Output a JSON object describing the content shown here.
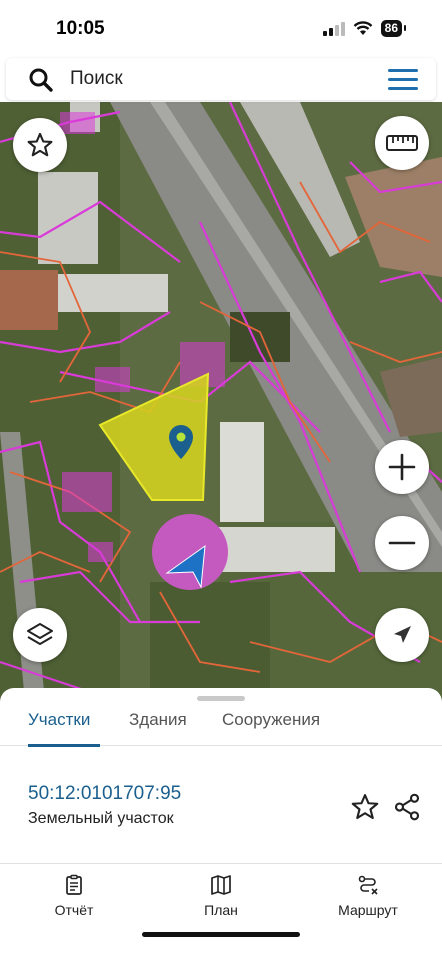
{
  "status_bar": {
    "time": "10:05",
    "battery": "86"
  },
  "search": {
    "placeholder": "Поиск"
  },
  "tabs": [
    {
      "label": "Участки",
      "active": true
    },
    {
      "label": "Здания",
      "active": false
    },
    {
      "label": "Сооружения",
      "active": false
    }
  ],
  "parcel": {
    "cadastral_number": "50:12:0101707:95",
    "type": "Земельный участок"
  },
  "bottom_nav": [
    {
      "label": "Отчёт",
      "icon": "report-icon"
    },
    {
      "label": "План",
      "icon": "map-plan-icon"
    },
    {
      "label": "Маршрут",
      "icon": "route-icon"
    }
  ],
  "colors": {
    "accent": "#1a5f8e",
    "parcel_fill": "#d4d21f",
    "boundary_pink": "#d93bd8",
    "boundary_orange": "#e3663a"
  }
}
